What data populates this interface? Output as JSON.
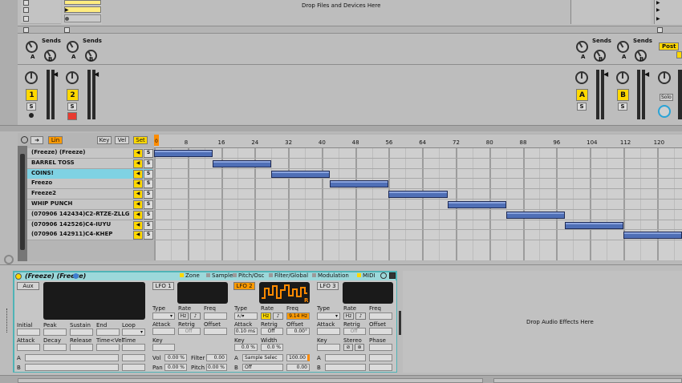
{
  "session": {
    "drop_files_text": "Drop Files and Devices Here",
    "sends_label": "Sends",
    "send_a": "A",
    "send_b": "B",
    "tracks": [
      {
        "number": "1",
        "solo": "S"
      },
      {
        "number": "2",
        "solo": "S"
      }
    ],
    "returns": [
      {
        "letter": "A",
        "solo": "S"
      },
      {
        "letter": "B",
        "solo": "S"
      }
    ],
    "master": {
      "post_label": "Post",
      "solo_label": "Solo"
    }
  },
  "midi_editor": {
    "fold_button": "Lin",
    "key_button": "Key",
    "vel_button": "Vel",
    "set_button": "Set",
    "ruler": [
      "8",
      "16",
      "24",
      "32",
      "40",
      "48",
      "56",
      "64",
      "72",
      "80",
      "88",
      "96",
      "104",
      "112",
      "120"
    ],
    "ruler_first": "0",
    "lanes": [
      {
        "name": "(Freeze) (Freeze)",
        "solo": "S",
        "note": {
          "start": 0,
          "end": 14
        }
      },
      {
        "name": "BARREL TOSS",
        "solo": "S",
        "note": {
          "start": 14,
          "end": 28
        }
      },
      {
        "name": "COINS!",
        "solo": "S",
        "note": {
          "start": 28,
          "end": 42
        }
      },
      {
        "name": "Freezo",
        "solo": "S",
        "note": {
          "start": 42,
          "end": 56
        }
      },
      {
        "name": "Freeze2",
        "solo": "S",
        "note": {
          "start": 56,
          "end": 70
        }
      },
      {
        "name": "WHIP PUNCH",
        "solo": "S",
        "note": {
          "start": 70,
          "end": 84
        }
      },
      {
        "name": "(070906 142434)C2-RTZE-ZLLG",
        "solo": "S",
        "note": {
          "start": 84,
          "end": 98
        }
      },
      {
        "name": "(070906 142526)C4-IUYU",
        "solo": "S",
        "note": {
          "start": 98,
          "end": 112
        }
      },
      {
        "name": "(070906 142911)C4-KHEP",
        "solo": "S",
        "note": {
          "start": 112,
          "end": 126
        }
      }
    ],
    "selected_lane": 2
  },
  "device": {
    "title": "(Freeze) (Freeze)",
    "tabs": [
      "Zone",
      "Sample",
      "Pitch/Osc",
      "Filter/Global",
      "Modulation",
      "MIDI"
    ],
    "aux_label": "Aux",
    "env_labels": [
      "Initial",
      "Peak",
      "Sustain",
      "End",
      "Loop"
    ],
    "env_labels2": [
      "Attack",
      "Decay",
      "Release",
      "Time<Vel",
      "Time"
    ],
    "lfo1": {
      "label": "LFO 1",
      "type": "Type",
      "rate": "Rate",
      "freq": "Freq",
      "attack": "Attack",
      "retrig": "Retrig",
      "offset": "Offset",
      "retrig_value": "Off",
      "hz": "Hz",
      "key": "Key"
    },
    "lfo2": {
      "label": "LFO 2",
      "type": "Type",
      "rate": "Rate",
      "freq": "Freq",
      "hz": "Hz",
      "freq_value": "9.14 Hz",
      "attack": "Attack",
      "attack_value": "0.10 ms",
      "retrig": "Retrig",
      "retrig_value": "Off",
      "offset": "Offset",
      "offset_value": "0.00°",
      "key": "Key",
      "key_value": "0.0 %",
      "width": "Width",
      "width_value": "0.0 %",
      "mod_a": "Sample Selec",
      "mod_a_amount": "100.00",
      "mod_b": "Off",
      "mod_b_amount": "0.00",
      "r_label": "R"
    },
    "lfo3": {
      "label": "LFO 3",
      "type": "Type",
      "rate": "Rate",
      "freq": "Freq",
      "hz": "Hz",
      "attack": "Attack",
      "retrig": "Retrig",
      "offset": "Offset",
      "retrig_value": "Off",
      "key": "Key",
      "stereo": "Stereo",
      "phase": "Phase"
    },
    "vol_label": "Vol",
    "vol_value": "0.00 %",
    "filter_label": "Filter",
    "filter_value": "0.00",
    "pan_label": "Pan",
    "pan_value": "0.00 %",
    "pitch_label": "Pitch",
    "pitch_value": "0.00 %",
    "a_label": "A",
    "b_label": "B",
    "drop_audio_effects": "Drop Audio Effects Here"
  }
}
